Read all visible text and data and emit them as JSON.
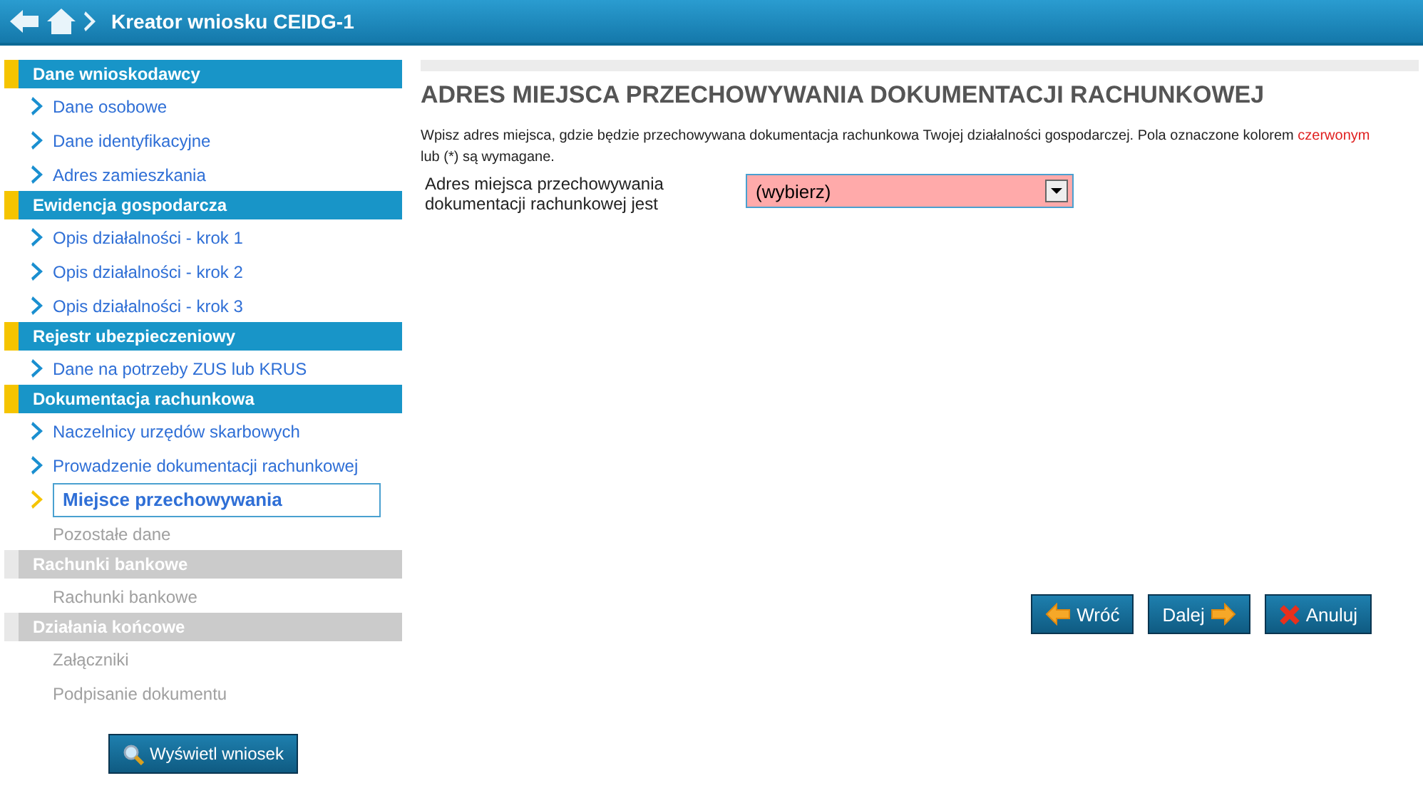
{
  "header": {
    "title": "Kreator wniosku CEIDG-1"
  },
  "sidebar": {
    "sections": [
      {
        "title": "Dane wnioskodawcy",
        "disabled": false,
        "items": [
          {
            "label": "Dane osobowe",
            "selected": false,
            "disabled": false
          },
          {
            "label": "Dane identyfikacyjne",
            "selected": false,
            "disabled": false
          },
          {
            "label": "Adres zamieszkania",
            "selected": false,
            "disabled": false
          }
        ]
      },
      {
        "title": "Ewidencja gospodarcza",
        "disabled": false,
        "items": [
          {
            "label": "Opis działalności - krok 1",
            "selected": false,
            "disabled": false
          },
          {
            "label": "Opis działalności - krok 2",
            "selected": false,
            "disabled": false
          },
          {
            "label": "Opis działalności - krok 3",
            "selected": false,
            "disabled": false
          }
        ]
      },
      {
        "title": "Rejestr ubezpieczeniowy",
        "disabled": false,
        "items": [
          {
            "label": "Dane na potrzeby ZUS lub KRUS",
            "selected": false,
            "disabled": false
          }
        ]
      },
      {
        "title": "Dokumentacja rachunkowa",
        "disabled": false,
        "items": [
          {
            "label": "Naczelnicy urzędów skarbowych",
            "selected": false,
            "disabled": false
          },
          {
            "label": "Prowadzenie dokumentacji rachunkowej",
            "selected": false,
            "disabled": false
          },
          {
            "label": "Miejsce przechowywania",
            "selected": true,
            "disabled": false
          },
          {
            "label": "Pozostałe dane",
            "selected": false,
            "disabled": true
          }
        ]
      },
      {
        "title": "Rachunki bankowe",
        "disabled": true,
        "items": [
          {
            "label": "Rachunki bankowe",
            "selected": false,
            "disabled": true
          }
        ]
      },
      {
        "title": "Działania końcowe",
        "disabled": true,
        "items": [
          {
            "label": "Załączniki",
            "selected": false,
            "disabled": true
          },
          {
            "label": "Podpisanie dokumentu",
            "selected": false,
            "disabled": true
          }
        ]
      }
    ],
    "preview_button": "Wyświetl wniosek"
  },
  "content": {
    "heading": "ADRES MIEJSCA PRZECHOWYWANIA DOKUMENTACJI RACHUNKOWEJ",
    "intro": [
      "Wpisz adres miejsca, gdzie będzie przechowywana dokumentacja rachunkowa Twojej działalności gospodarczej. Pola oznaczone kolorem ",
      "czerwonym",
      " lub (*) są wymagane."
    ],
    "field": {
      "label": "Adres miejsca przechowywania dokumentacji rachunkowej jest",
      "value": "(wybierz)",
      "required": true
    },
    "buttons": [
      {
        "label": "Wróć",
        "kind": "back"
      },
      {
        "label": "Dalej",
        "kind": "next"
      },
      {
        "label": "Anuluj",
        "kind": "cancel"
      }
    ]
  }
}
